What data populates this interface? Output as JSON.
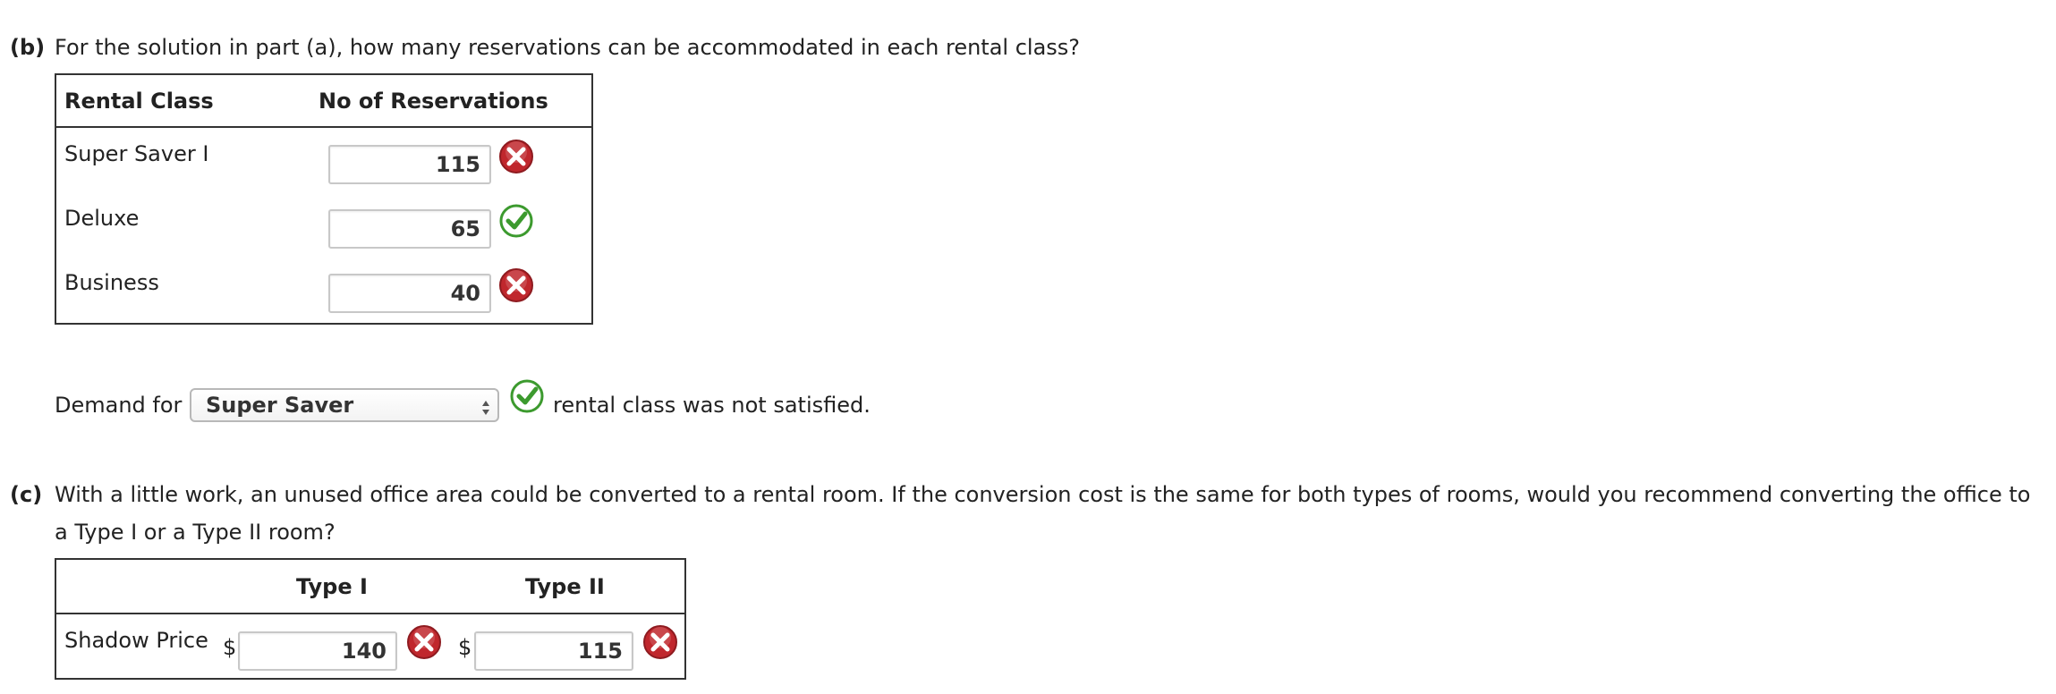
{
  "part_b": {
    "label": "(b)",
    "question": "For the solution in part (a), how many reservations can be accommodated in each rental class?",
    "table": {
      "headers": [
        "Rental Class",
        "No of Reservations"
      ],
      "rows": [
        {
          "label": "Super Saver I",
          "value": "115",
          "status": "incorrect"
        },
        {
          "label": "Deluxe",
          "value": "65",
          "status": "correct"
        },
        {
          "label": "Business",
          "value": "40",
          "status": "incorrect"
        }
      ]
    },
    "demand": {
      "prefix": "Demand for",
      "selected": "Super Saver",
      "status": "correct",
      "suffix": "rental class was not satisfied."
    }
  },
  "part_c": {
    "label": "(c)",
    "question_line1": "With a little work, an unused office area could be converted to a rental room. If the conversion cost is the same for both types of rooms, would you recommend converting the office to",
    "question_line2": "a Type I or a Type II room?",
    "table": {
      "headers": [
        "Type I",
        "Type II"
      ],
      "row_label": "Shadow Price",
      "currency": "$",
      "values": [
        {
          "value": "140",
          "status": "incorrect"
        },
        {
          "value": "115",
          "status": "incorrect"
        }
      ]
    }
  },
  "colors": {
    "incorrect": "#c0272d",
    "correct": "#3c9a2e",
    "border": "#333333",
    "text": "#222222"
  }
}
